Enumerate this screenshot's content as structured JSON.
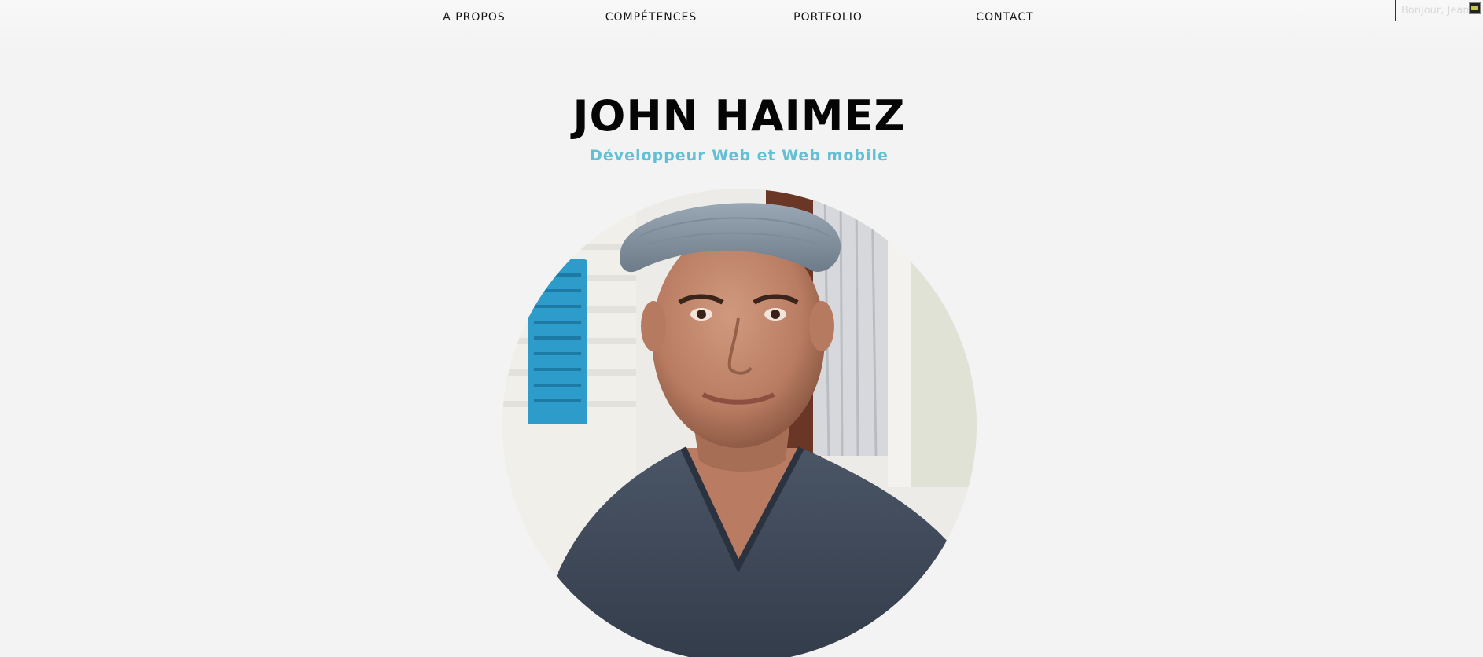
{
  "nav": {
    "items": [
      {
        "label": "A PROPOS"
      },
      {
        "label": "COMPÉTENCES"
      },
      {
        "label": "PORTFOLIO"
      },
      {
        "label": "CONTACT"
      }
    ]
  },
  "corner": {
    "greeting": "Bonjour, Jean",
    "icon": "flag-icon"
  },
  "hero": {
    "name": "JOHN HAIMEZ",
    "title": "Développeur Web et Web mobile"
  },
  "colors": {
    "background": "#f3f3f3",
    "accent": "#63bfd3",
    "heading": "#050505"
  }
}
